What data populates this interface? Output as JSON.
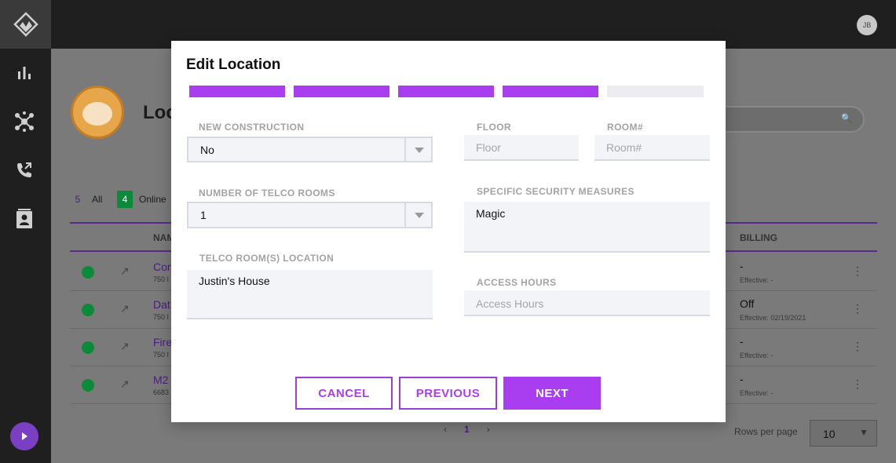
{
  "topbar": {
    "user_initials": "JB"
  },
  "sidebar": {
    "icons": [
      "chart-bars-icon",
      "network-hub-icon",
      "phone-forward-icon",
      "contacts-icon"
    ]
  },
  "page": {
    "title": "Loc",
    "filters": [
      {
        "count": "5",
        "label": "All",
        "color": "#7b3fc4"
      },
      {
        "count": "4",
        "label": "Online",
        "color": "#0b8a3a"
      }
    ],
    "table": {
      "headers": {
        "name": "NAM",
        "billing": "BILLING"
      },
      "rows": [
        {
          "name": "Cor",
          "sub": "750 I",
          "billing": "-",
          "effective": "Effective: -"
        },
        {
          "name": "Dat",
          "sub": "750 I",
          "billing": "Off",
          "effective": "Effective: 02/19/2021"
        },
        {
          "name": "Fire",
          "sub": "750 I",
          "billing": "-",
          "effective": "Effective: -"
        },
        {
          "name": "M2",
          "sub": "6683",
          "billing": "-",
          "effective": "Effective: -"
        }
      ]
    },
    "pagination": {
      "prev": "‹",
      "current": "1",
      "next": "›"
    },
    "rows_per_page": {
      "label": "Rows per page",
      "value": "10"
    }
  },
  "modal": {
    "title": "Edit Location",
    "steps_total": 5,
    "steps_completed": 4,
    "new_construction": {
      "label": "NEW CONSTRUCTION",
      "value": "No"
    },
    "telco_rooms": {
      "label": "NUMBER OF TELCO ROOMS",
      "value": "1"
    },
    "telco_location": {
      "label": "TELCO ROOM(S) LOCATION",
      "value": "Justin's House"
    },
    "floor": {
      "label": "FLOOR",
      "placeholder": "Floor",
      "value": ""
    },
    "room": {
      "label": "ROOM#",
      "placeholder": "Room#",
      "value": ""
    },
    "security": {
      "label": "SPECIFIC SECURITY MEASURES",
      "value": "Magic"
    },
    "access_hours": {
      "label": "ACCESS HOURS",
      "placeholder": "Access Hours",
      "value": ""
    },
    "buttons": {
      "cancel": "CANCEL",
      "previous": "PREVIOUS",
      "next": "NEXT"
    },
    "accent_color": "#a93ef0"
  }
}
